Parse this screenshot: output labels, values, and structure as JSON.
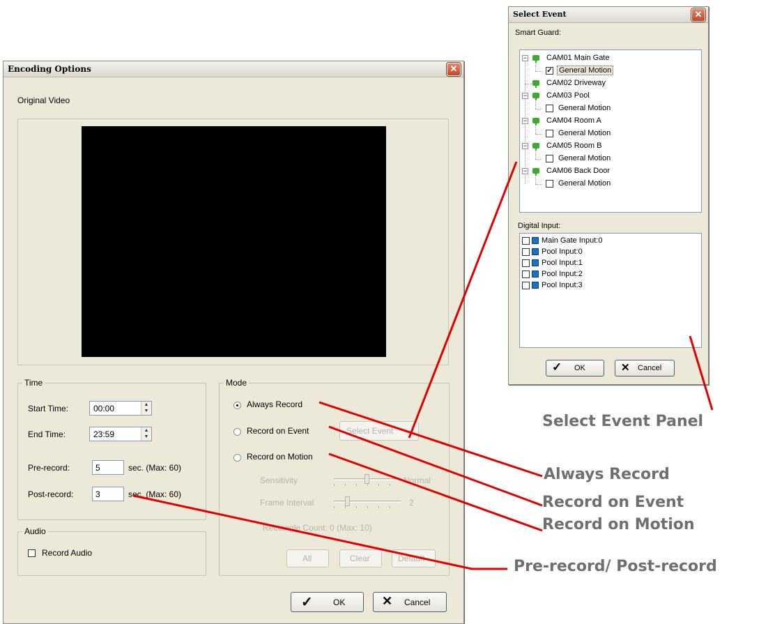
{
  "encoding": {
    "title": "Encoding Options",
    "close": "✕",
    "original_video": "Original Video",
    "time": {
      "legend": "Time",
      "start_label": "Start Time:",
      "start_value": "00:00",
      "end_label": "End Time:",
      "end_value": "23:59",
      "pre_label": "Pre-record:",
      "pre_value": "5",
      "pre_unit": "sec. (Max: 60)",
      "post_label": "Post-record:",
      "post_value": "3",
      "post_unit": "sec. (Max: 60)"
    },
    "audio": {
      "legend": "Audio",
      "record_audio": "Record Audio"
    },
    "mode": {
      "legend": "Mode",
      "always": "Always Record",
      "on_event": "Record on Event",
      "select_event": "Select Event",
      "on_motion": "Record on Motion",
      "sensitivity": "Sensitivity",
      "sensitivity_value": "Normal",
      "frame_interval": "Frame Interval",
      "frame_interval_value": "2",
      "rect_count": "Rectangle Count: 0  (Max: 10)",
      "all": "All",
      "clear": "Clear",
      "default": "Default"
    },
    "ok": "OK",
    "cancel": "Cancel",
    "selected_mode": "Always Record"
  },
  "select_event": {
    "title": "Select Event",
    "close": "✕",
    "smart_guard_label": "Smart Guard:",
    "cameras": [
      {
        "name": "CAM01 Main Gate",
        "event": "General Motion",
        "checked": true
      },
      {
        "name": "CAM02 Driveway"
      },
      {
        "name": "CAM03 Pool",
        "event": "General Motion",
        "checked": false
      },
      {
        "name": "CAM04 Room A",
        "event": "General Motion",
        "checked": false
      },
      {
        "name": "CAM05 Room B",
        "event": "General Motion",
        "checked": false
      },
      {
        "name": "CAM06 Back Door",
        "event": "General Motion",
        "checked": false
      }
    ],
    "digital_input_label": "Digital Input:",
    "inputs": [
      "Main Gate Input:0",
      "Pool Input:0",
      "Pool Input:1",
      "Pool Input:2",
      "Pool Input:3"
    ],
    "ok": "OK",
    "cancel": "Cancel"
  },
  "annotations": {
    "select_event_panel": "Select Event Panel",
    "always_record": "Always Record",
    "record_on_event": "Record on Event",
    "record_on_motion": "Record on Motion",
    "pre_post_record": "Pre-record/ Post-record"
  },
  "colors": {
    "annotation_line": "#e10000",
    "annotation_text": "#6f6f6f",
    "video_bg": "#000000"
  },
  "icons": {
    "check": "check-icon",
    "cancel_x": "cancel-x-icon",
    "camera": "camera-icon",
    "digital_input": "digital-input-icon"
  }
}
